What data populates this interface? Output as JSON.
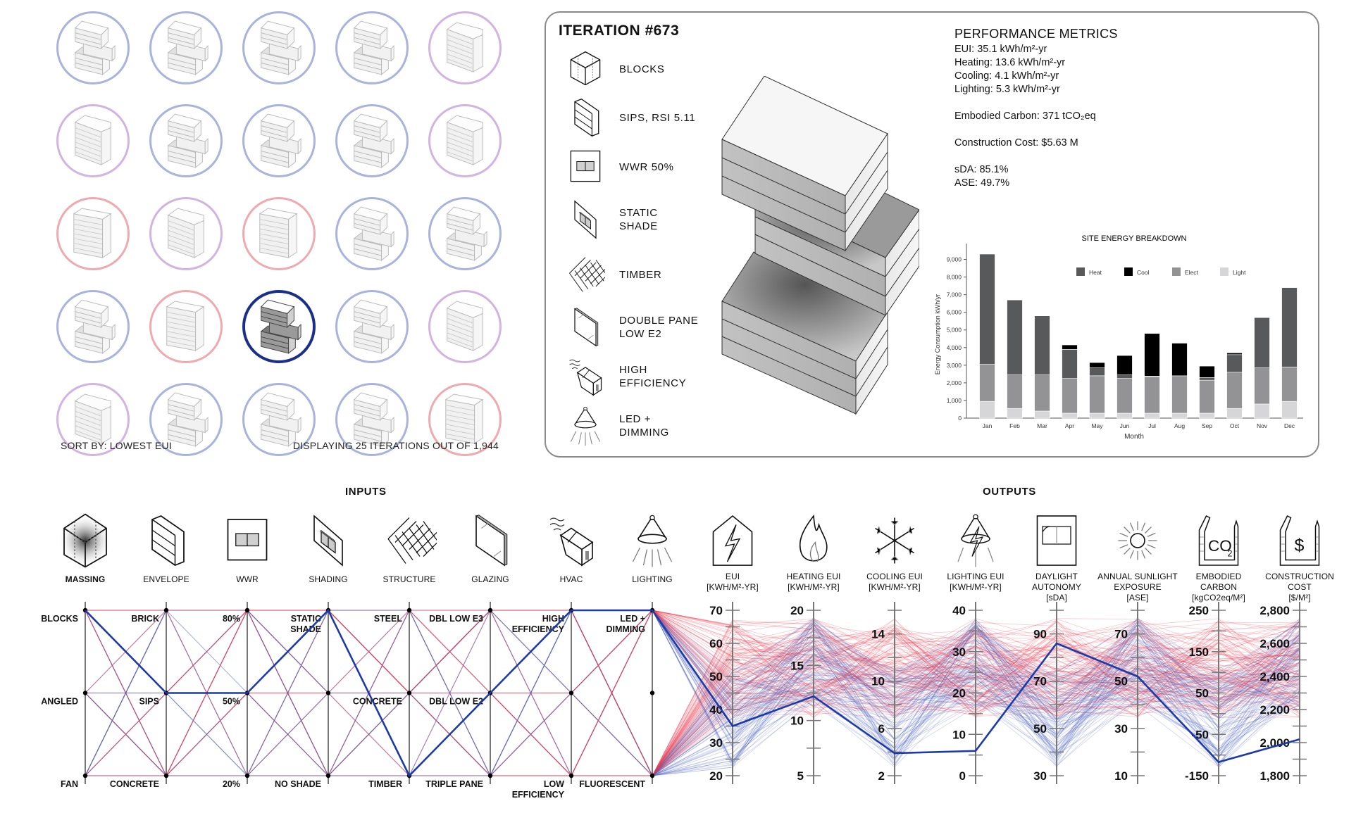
{
  "grid": {
    "sort_label": "SORT BY: LOWEST EUI",
    "count_label": "DISPLAYING 25 ITERATIONS OUT OF 1,944",
    "tiles": [
      {
        "massing": "blocks",
        "color": "blue"
      },
      {
        "massing": "blocks",
        "color": "blue"
      },
      {
        "massing": "blocks",
        "color": "blue"
      },
      {
        "massing": "blocks",
        "color": "blue"
      },
      {
        "massing": "angled",
        "color": "purple"
      },
      {
        "massing": "angled",
        "color": "purple"
      },
      {
        "massing": "blocks",
        "color": "blue"
      },
      {
        "massing": "blocks",
        "color": "blue"
      },
      {
        "massing": "blocks",
        "color": "blue"
      },
      {
        "massing": "angled",
        "color": "purple"
      },
      {
        "massing": "fan",
        "color": "pink"
      },
      {
        "massing": "angled",
        "color": "purple"
      },
      {
        "massing": "fan",
        "color": "pink"
      },
      {
        "massing": "blocks",
        "color": "blue"
      },
      {
        "massing": "blocks",
        "color": "blue"
      },
      {
        "massing": "blocks",
        "color": "blue"
      },
      {
        "massing": "fan",
        "color": "pink"
      },
      {
        "massing": "blocks",
        "color": "sel",
        "selected": true
      },
      {
        "massing": "blocks",
        "color": "blue"
      },
      {
        "massing": "angled",
        "color": "purple"
      },
      {
        "massing": "angled",
        "color": "purple"
      },
      {
        "massing": "blocks",
        "color": "blue"
      },
      {
        "massing": "blocks",
        "color": "blue"
      },
      {
        "massing": "blocks",
        "color": "blue"
      },
      {
        "massing": "fan",
        "color": "pink"
      }
    ]
  },
  "detail": {
    "title": "ITERATION #673",
    "specs": [
      {
        "icon": "blocks-massing-icon",
        "label": "BLOCKS"
      },
      {
        "icon": "sips-envelope-icon",
        "label": "SIPS, RSI 5.11"
      },
      {
        "icon": "wwr-window-icon",
        "label": "WWR 50%"
      },
      {
        "icon": "static-shade-icon",
        "label": "STATIC\nSHADE"
      },
      {
        "icon": "timber-structure-icon",
        "label": "TIMBER"
      },
      {
        "icon": "double-pane-glazing-icon",
        "label": "DOUBLE PANE\nLOW E2"
      },
      {
        "icon": "hvac-unit-icon",
        "label": "HIGH\nEFFICIENCY"
      },
      {
        "icon": "led-lamp-icon",
        "label": "LED +\nDIMMING"
      }
    ],
    "metrics": {
      "heading": "PERFORMANCE METRICS",
      "eui": "EUI: 35.1 kWh/m²-yr",
      "heating": "Heating: 13.6 kWh/m²-yr",
      "cooling": "Cooling: 4.1 kWh/m²-yr",
      "lighting": "Lighting: 5.3 kWh/m²-yr",
      "carbon": "Embodied Carbon: 371 tCO₂eq",
      "cost": "Construction Cost: $5.63 M",
      "sda": "sDA: 85.1%",
      "ase": "ASE: 49.7%"
    }
  },
  "chart_data": {
    "type": "bar",
    "stacked": true,
    "title": "SITE ENERGY BREAKDOWN",
    "xlabel": "Month",
    "ylabel": "Energy Consumption kWh/yr",
    "ylim": [
      0,
      9500
    ],
    "yticks": [
      0,
      1000,
      2000,
      3000,
      4000,
      5000,
      6000,
      7000,
      8000,
      9000
    ],
    "ytick_labels": [
      "0",
      "1,000",
      "2,000",
      "3,000",
      "4,000",
      "5,000",
      "6,000",
      "7,000",
      "8,000",
      "9,000"
    ],
    "legend_position": "top-center",
    "categories": [
      "Jan",
      "Feb",
      "Mar",
      "Apr",
      "May",
      "Jun",
      "Jul",
      "Aug",
      "Sep",
      "Oct",
      "Nov",
      "Dec"
    ],
    "series": [
      {
        "name": "Light",
        "color": "#d6d6d8",
        "values": [
          950,
          550,
          400,
          280,
          280,
          280,
          280,
          280,
          280,
          550,
          800,
          950
        ]
      },
      {
        "name": "Elect",
        "color": "#939396",
        "values": [
          2100,
          1900,
          2050,
          1970,
          2120,
          1970,
          2070,
          2120,
          1870,
          2050,
          2050,
          1950
        ]
      },
      {
        "name": "Heat",
        "color": "#58595b",
        "values": [
          6250,
          4250,
          3350,
          1650,
          450,
          200,
          30,
          0,
          150,
          1000,
          2850,
          4500
        ]
      },
      {
        "name": "Cool",
        "color": "#000000",
        "values": [
          0,
          0,
          0,
          250,
          300,
          1100,
          2420,
          1850,
          650,
          100,
          0,
          0
        ]
      }
    ],
    "legend_order": [
      "Heat",
      "Cool",
      "Elect",
      "Light"
    ]
  },
  "parallel": {
    "inputs_title": "INPUTS",
    "outputs_title": "OUTPUTS",
    "selected_color": "#1c3aa9",
    "inputs": [
      {
        "name": "MASSING",
        "icon": "massing-cube-icon",
        "levels": [
          "BLOCKS",
          "ANGLED",
          "FAN"
        ],
        "selected": 0
      },
      {
        "name": "ENVELOPE",
        "icon": "envelope-panel-icon",
        "levels": [
          "BRICK",
          "SIPS",
          "CONCRETE"
        ],
        "selected": 1
      },
      {
        "name": "WWR",
        "icon": "window-wall-ratio-icon",
        "levels": [
          "80%",
          "50%",
          "20%"
        ],
        "selected": 1
      },
      {
        "name": "SHADING",
        "icon": "shading-icon",
        "levels": [
          "STATIC\nSHADE",
          "",
          "NO SHADE"
        ],
        "selected": 0
      },
      {
        "name": "STRUCTURE",
        "icon": "structure-grid-icon",
        "levels": [
          "STEEL",
          "CONCRETE",
          "TIMBER"
        ],
        "selected": 2
      },
      {
        "name": "GLAZING",
        "icon": "glazing-pane-icon",
        "levels": [
          "DBL LOW E3",
          "DBL LOW E2",
          "TRIPLE PANE"
        ],
        "selected": 1
      },
      {
        "name": "HVAC",
        "icon": "hvac-icon",
        "levels": [
          "HIGH\nEFFICIENCY",
          "",
          "LOW\nEFFICIENCY"
        ],
        "selected": 0
      },
      {
        "name": "LIGHTING",
        "icon": "lighting-lamp-icon",
        "levels": [
          "LED +\nDIMMING",
          "",
          "FLUORESCENT"
        ],
        "selected": 0
      }
    ],
    "outputs": [
      {
        "name": "EUI\n[KWH/M²-YR]",
        "icon": "eui-house-bolt-icon",
        "range": [
          20,
          70
        ],
        "ticks": [
          20,
          30,
          40,
          50,
          60,
          70
        ],
        "selected": 35
      },
      {
        "name": "HEATING EUI\n[KWH/M²-YR]",
        "icon": "flame-icon",
        "range": [
          5,
          20
        ],
        "ticks": [
          5,
          10,
          15,
          20
        ],
        "selected": 12.2
      },
      {
        "name": "COOLING EUI\n[KWH/M²-YR]",
        "icon": "snowflake-icon",
        "range": [
          2,
          16
        ],
        "ticks": [
          2,
          6,
          10,
          14
        ],
        "selected": 3.9
      },
      {
        "name": "LIGHTING EUI\n[KWH/M²-YR]",
        "icon": "lightbulb-bolt-icon",
        "range": [
          0,
          40
        ],
        "ticks": [
          0,
          10,
          20,
          30,
          40
        ],
        "selected": 6
      },
      {
        "name": "DAYLIGHT\nAUTONOMY\n[sDA]",
        "icon": "daylight-window-icon",
        "range": [
          30,
          100
        ],
        "ticks": [
          30,
          50,
          70,
          90
        ],
        "selected": 86
      },
      {
        "name": "ANNUAL SUNLIGHT\nEXPOSURE\n[ASE]",
        "icon": "sun-icon",
        "range": [
          10,
          80
        ],
        "ticks": [
          10,
          30,
          50,
          70
        ],
        "selected": 52
      },
      {
        "name": "EMBODIED\nCARBON\n[kgCO2eq/M²]",
        "icon": "co2-icon",
        "range": [
          -150,
          250
        ],
        "ticks": [
          -150,
          -50,
          50,
          150,
          250
        ],
        "selected": -117
      },
      {
        "name": "CONSTRUCTION\nCOST\n[$/M²]",
        "icon": "dollar-icon",
        "range": [
          1800,
          2800
        ],
        "ticks": [
          1800,
          2000,
          2200,
          2400,
          2600,
          2800
        ],
        "tick_labels": [
          "1,800",
          "2,000",
          "2,200",
          "2,400",
          "2,600",
          "2,800"
        ],
        "selected": 2020
      }
    ]
  }
}
